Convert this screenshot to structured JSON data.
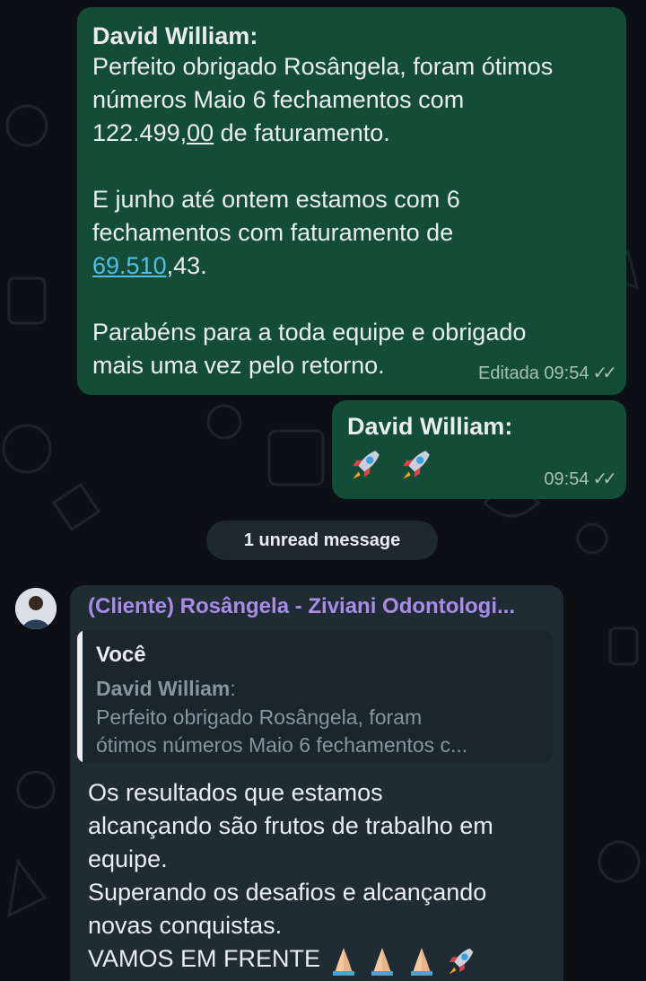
{
  "messages": {
    "m1": {
      "sender": "David William",
      "line1": "Perfeito obrigado Rosângela, foram ótimos",
      "line2": "números Maio 6 fechamentos com",
      "line3_a": "122.499,",
      "line3_u": "00",
      "line3_b": " de faturamento.",
      "line4": "E junho até ontem estamos com 6",
      "line5": "fechamentos com faturamento de",
      "line6_link": "69.510",
      "line6_rest": ",43.",
      "line7": "Parabéns para a toda equipe e obrigado",
      "line8": "mais uma vez pelo retorno.",
      "meta": "Editada 09:54"
    },
    "m2": {
      "sender": "David William",
      "emoji": "rocket-emoji ×2",
      "time": "09:54"
    },
    "m3": {
      "group_name": "(Cliente) Rosângela - Ziviani Odontologi...",
      "quote_title": "Você",
      "quote_sender": "David William",
      "quote_line1": "Perfeito obrigado Rosângela, foram",
      "quote_line2": "ótimos números Maio 6 fechamentos c...",
      "line1": "Os resultados que estamos",
      "line2": "alcançando são frutos de trabalho em",
      "line3": "equipe.",
      "line4": "Superando os desafios e alcançando",
      "line5": "novas conquistas.",
      "line6": "VAMOS EM FRENTE"
    }
  },
  "unread_label": "1 unread message",
  "colors": {
    "background": "#0b1014",
    "outgoing": "#144d37",
    "incoming": "#202c33",
    "link": "#53bdeb",
    "group_name": "#a88ce6"
  }
}
